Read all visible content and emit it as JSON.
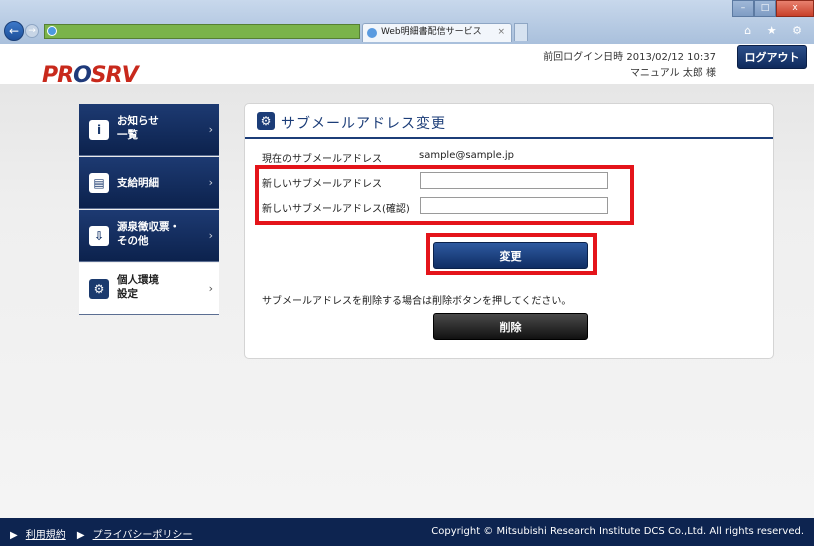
{
  "browser": {
    "tab_title": "Web明細書配信サービス",
    "tab_close": "×",
    "back_glyph": "←",
    "forward_glyph": "→",
    "window_min": "–",
    "window_max": "□",
    "window_close": "x",
    "tool_icons": "⌂ ★ ⚙"
  },
  "header": {
    "logo_left": "PR",
    "logo_o": "O",
    "logo_right": "SRV",
    "last_login": "前回ログイン日時 2013/02/12 10:37",
    "user_name": "マニュアル 太郎 様",
    "logout_label": "ログアウト"
  },
  "sidebar": {
    "items": [
      {
        "icon": "i",
        "label": "お知らせ\n一覧",
        "chevron": "›"
      },
      {
        "icon": "▤",
        "label": "支給明細",
        "chevron": "›"
      },
      {
        "icon": "⇩",
        "label": "源泉徴収票・\nその他",
        "chevron": "›"
      },
      {
        "icon": "⚙",
        "label": "個人環境\n設定",
        "chevron": "›"
      }
    ]
  },
  "panel": {
    "icon": "⚙",
    "title": "サブメールアドレス変更",
    "current_label": "現在のサブメールアドレス",
    "current_value": "sample@sample.jp",
    "new_label": "新しいサブメールアドレス",
    "new_value": "",
    "confirm_label": "新しいサブメールアドレス(確認)",
    "confirm_value": "",
    "change_button": "変更",
    "delete_note": "サブメールアドレスを削除する場合は削除ボタンを押してください。",
    "delete_button": "削除"
  },
  "footer": {
    "link_terms": "利用規約",
    "link_privacy": "プライバシーポリシー",
    "link_marker": "▶",
    "copyright": "Copyright © Mitsubishi Research Institute DCS Co.,Ltd. All rights reserved."
  },
  "colors": {
    "navy": "#1c3d78",
    "highlight_red": "#e4141a",
    "logo_red": "#c8291c"
  }
}
